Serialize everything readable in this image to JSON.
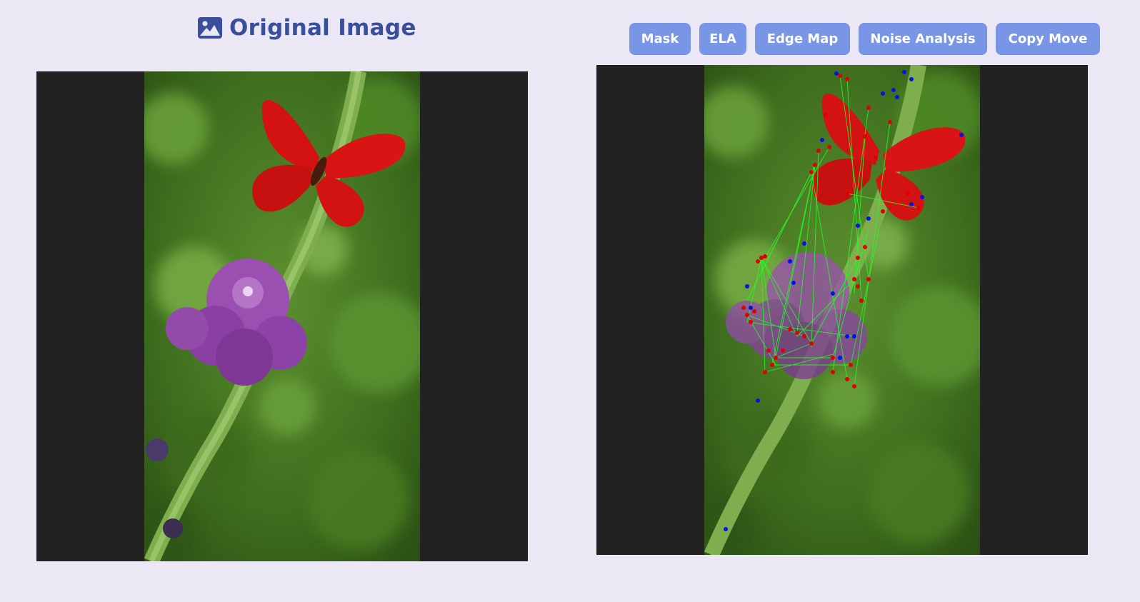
{
  "header": {
    "title": "Original Image",
    "icon": "image-icon"
  },
  "toolbar": {
    "buttons": [
      {
        "label": "Mask"
      },
      {
        "label": "ELA"
      },
      {
        "label": "Edge Map"
      },
      {
        "label": "Noise Analysis"
      },
      {
        "label": "Copy Move"
      }
    ]
  },
  "colors": {
    "background": "#ebe7f4",
    "title": "#3a4f9c",
    "button": "#7895e6",
    "panel": "#222222",
    "keypoint_source": "#e10000",
    "keypoint_match": "#0014e6",
    "match_line": "#22ff22"
  }
}
